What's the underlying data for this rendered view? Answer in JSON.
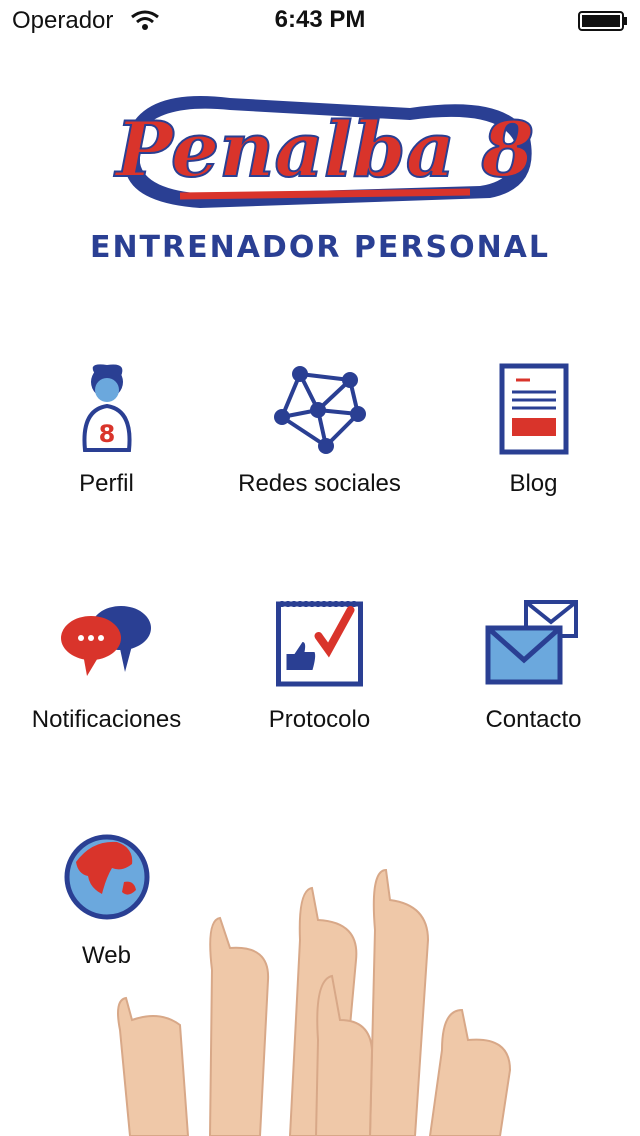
{
  "status_bar": {
    "carrier": "Operador",
    "time": "6:43 PM"
  },
  "brand": {
    "name": "Penalba 8",
    "subtitle": "ENTRENADOR PERSONAL"
  },
  "colors": {
    "brand_blue": "#2a3f93",
    "brand_red": "#d9342b",
    "light_blue": "#6ba8dd"
  },
  "menu": {
    "items": [
      {
        "label": "Perfil",
        "icon": "profile-icon"
      },
      {
        "label": "Redes sociales",
        "icon": "network-icon"
      },
      {
        "label": "Blog",
        "icon": "document-icon"
      },
      {
        "label": "Notificaciones",
        "icon": "chat-bubbles-icon"
      },
      {
        "label": "Protocolo",
        "icon": "checklist-icon"
      },
      {
        "label": "Contacto",
        "icon": "envelope-icon"
      },
      {
        "label": "Web",
        "icon": "globe-icon"
      }
    ]
  }
}
